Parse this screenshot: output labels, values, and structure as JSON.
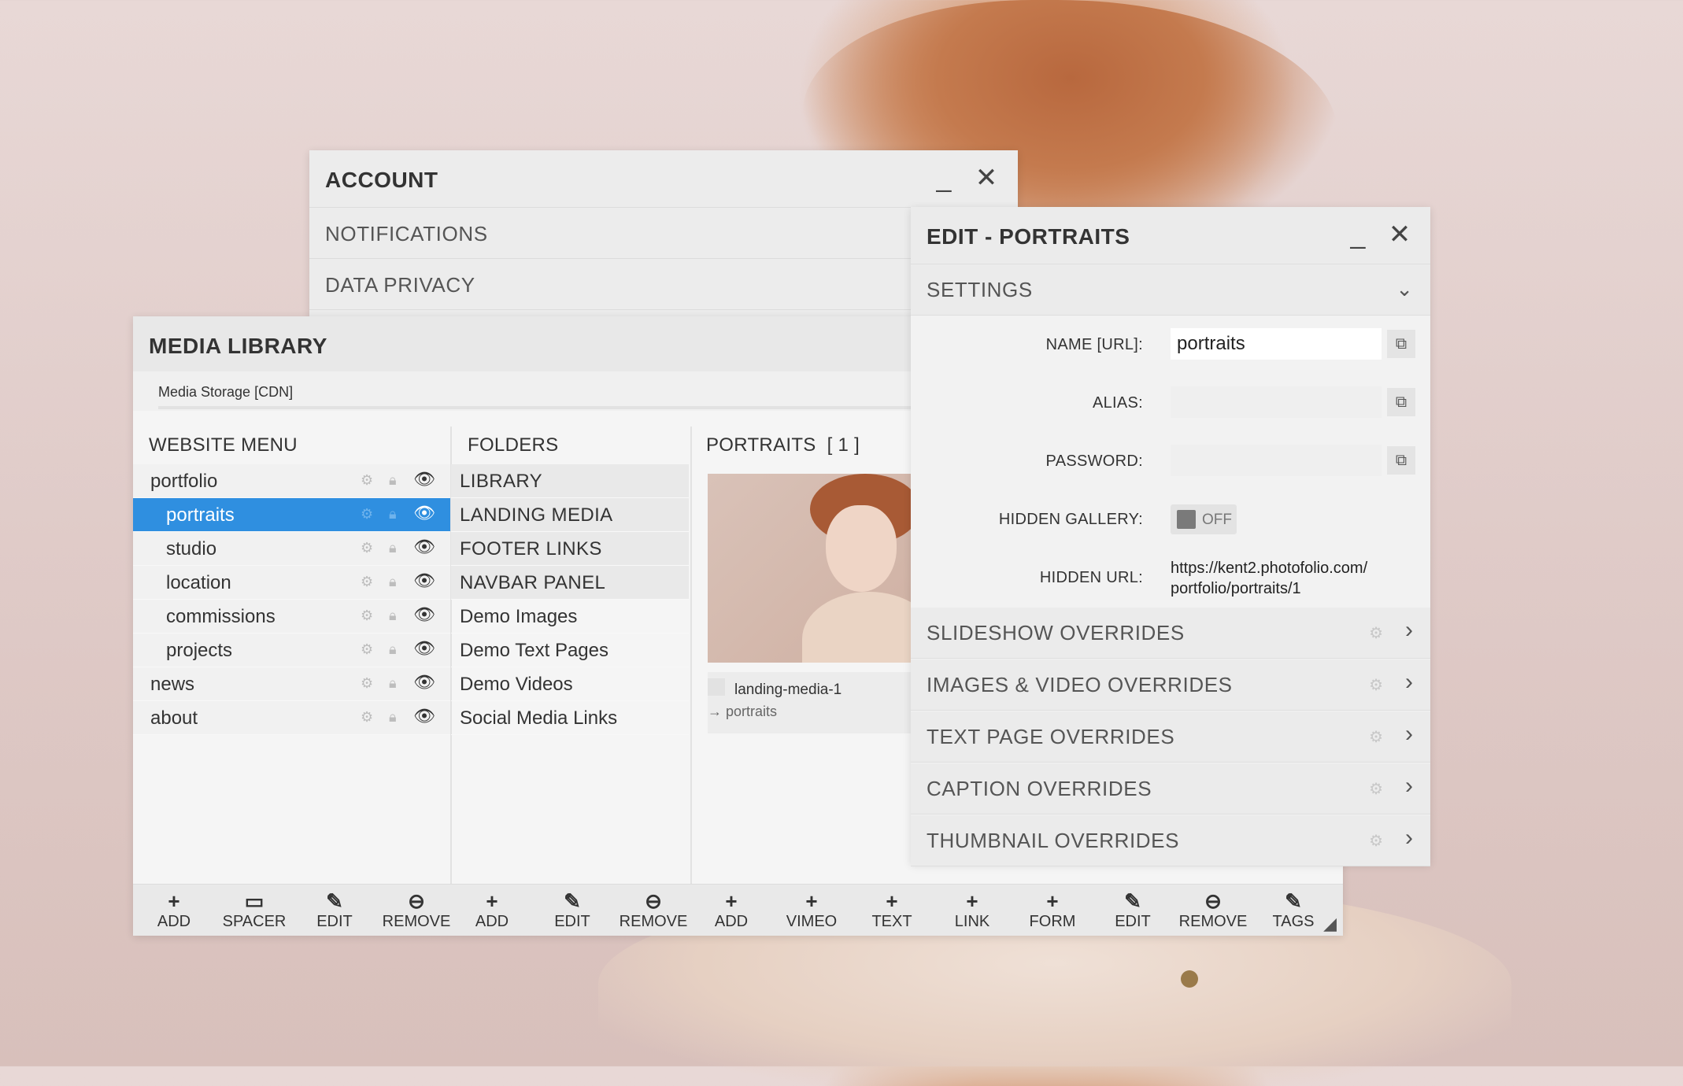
{
  "account": {
    "title": "ACCOUNT",
    "items": [
      "NOTIFICATIONS",
      "DATA PRIVACY"
    ]
  },
  "media_library": {
    "title": "MEDIA LIBRARY",
    "storage": "Media Storage [CDN]",
    "website_menu": {
      "header": "WEBSITE MENU",
      "items": [
        {
          "label": "portfolio",
          "level": 0,
          "selected": false
        },
        {
          "label": "portraits",
          "level": 1,
          "selected": true
        },
        {
          "label": "studio",
          "level": 1,
          "selected": false
        },
        {
          "label": "location",
          "level": 1,
          "selected": false
        },
        {
          "label": "commissions",
          "level": 1,
          "selected": false
        },
        {
          "label": "projects",
          "level": 1,
          "selected": false
        },
        {
          "label": "news",
          "level": 0,
          "selected": false
        },
        {
          "label": "about",
          "level": 0,
          "selected": false
        }
      ]
    },
    "folders": {
      "header": "FOLDERS",
      "items": [
        {
          "label": "LIBRARY",
          "system": true
        },
        {
          "label": "LANDING MEDIA",
          "system": true
        },
        {
          "label": "FOOTER LINKS",
          "system": true
        },
        {
          "label": "NAVBAR PANEL",
          "system": true
        },
        {
          "label": "Demo Images",
          "system": false
        },
        {
          "label": "Demo Text Pages",
          "system": false
        },
        {
          "label": "Demo Videos",
          "system": false
        },
        {
          "label": "Social Media Links",
          "system": false
        }
      ]
    },
    "gallery": {
      "header": "PORTRAITS",
      "count": "[ 1 ]",
      "item_name": "landing-media-1",
      "item_path": "→ portraits"
    },
    "toolbar": {
      "menu_buttons": [
        "ADD",
        "SPACER",
        "EDIT",
        "REMOVE"
      ],
      "folder_buttons": [
        "ADD",
        "EDIT",
        "REMOVE"
      ],
      "gallery_buttons": [
        "ADD",
        "VIMEO",
        "TEXT",
        "LINK",
        "FORM",
        "EDIT",
        "REMOVE",
        "TAGS"
      ]
    }
  },
  "edit_panel": {
    "title": "EDIT - PORTRAITS",
    "settings_label": "SETTINGS",
    "fields": {
      "name_label": "NAME [URL]:",
      "name_value": "portraits",
      "alias_label": "ALIAS:",
      "alias_value": "",
      "password_label": "PASSWORD:",
      "password_value": "",
      "hidden_gallery_label": "HIDDEN GALLERY:",
      "hidden_gallery_state": "OFF",
      "hidden_url_label": "HIDDEN URL:",
      "hidden_url_line1": "https://kent2.photofolio.com/",
      "hidden_url_line2": "portfolio/portraits/1"
    },
    "sections": [
      "SLIDESHOW OVERRIDES",
      "IMAGES & VIDEO OVERRIDES",
      "TEXT PAGE OVERRIDES",
      "CAPTION OVERRIDES",
      "THUMBNAIL OVERRIDES"
    ]
  }
}
